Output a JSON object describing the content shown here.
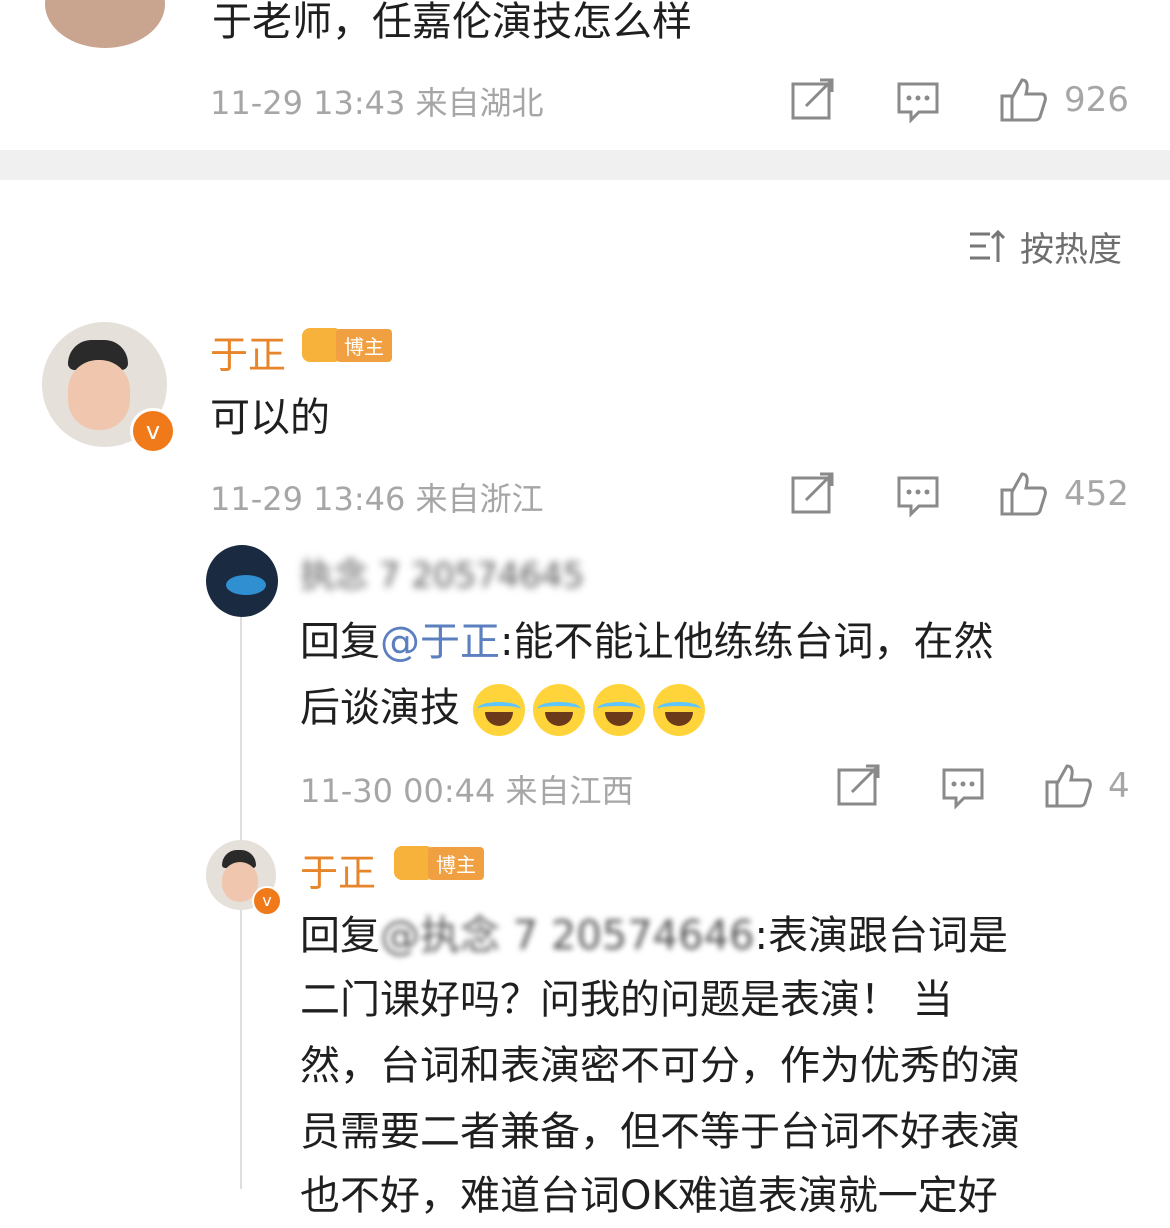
{
  "top_comment": {
    "text": "于老师，任嘉伦演技怎么样",
    "meta": "11-29 13:43 来自湖北",
    "likes": "926"
  },
  "sort": {
    "label": "按热度"
  },
  "reply1": {
    "name": "于正",
    "badge": "博主",
    "text": "可以的",
    "meta": "11-29 13:46 来自浙江",
    "likes": "452"
  },
  "sub1": {
    "name": "执念 7 20574645",
    "prefix": "回复",
    "mention": "@于正",
    "text_line1": ":能不能让他练练台词，在然",
    "text_line2": "后谈演技",
    "meta": "11-30 00:44 来自江西",
    "likes": "4"
  },
  "sub2": {
    "name": "于正",
    "badge": "博主",
    "prefix": "回复",
    "mention": "@执念 7 20574646",
    "line1": ":表演跟台词是",
    "line2": "二门课好吗？问我的问题是表演！ 当",
    "line3": "然，台词和表演密不可分，作为优秀的演",
    "line4": "员需要二者兼备，但不等于台词不好表演",
    "line5": "也不好，难道台词OK难道表演就一定好"
  }
}
